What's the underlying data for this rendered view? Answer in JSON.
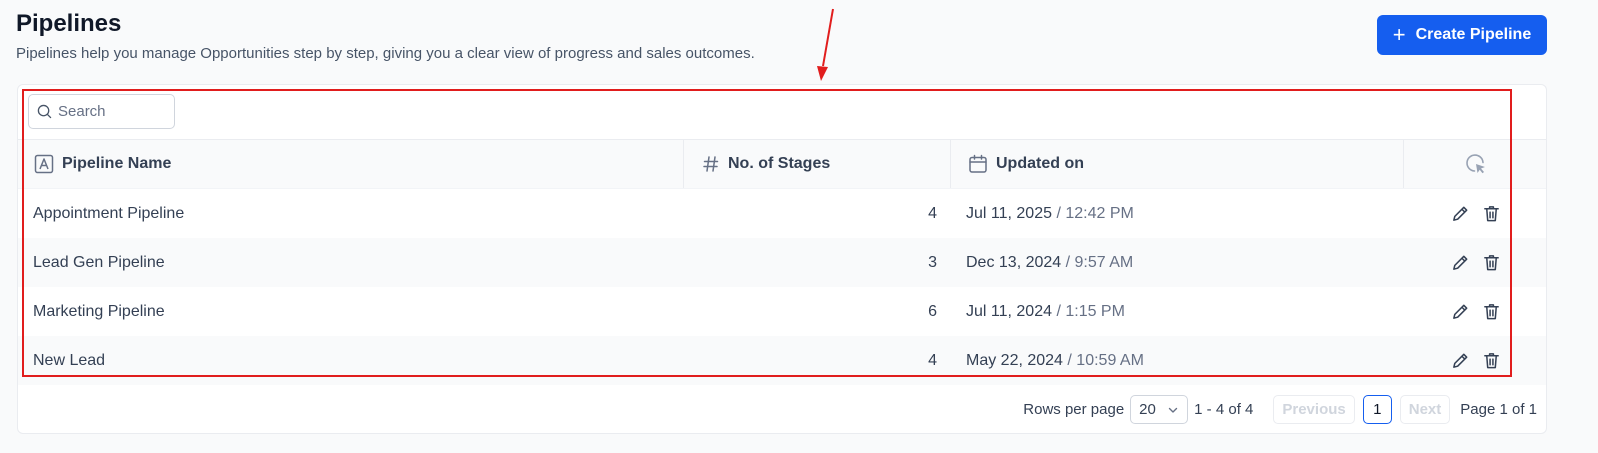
{
  "header": {
    "title": "Pipelines",
    "subtitle": "Pipelines help you manage Opportunities step by step, giving you a clear view of progress and sales outcomes.",
    "create_label": "Create Pipeline"
  },
  "search": {
    "placeholder": "Search"
  },
  "columns": {
    "name": "Pipeline Name",
    "stages": "No. of Stages",
    "updated": "Updated on"
  },
  "rows": [
    {
      "name": "Appointment Pipeline",
      "stages": "4",
      "date": "Jul 11, 2025",
      "sep": " / ",
      "time": "12:42 PM"
    },
    {
      "name": "Lead Gen Pipeline",
      "stages": "3",
      "date": "Dec 13, 2024",
      "sep": " / ",
      "time": "9:57 AM"
    },
    {
      "name": "Marketing Pipeline",
      "stages": "6",
      "date": "Jul 11, 2024",
      "sep": " / ",
      "time": "1:15 PM"
    },
    {
      "name": "New Lead",
      "stages": "4",
      "date": "May 22, 2024",
      "sep": " / ",
      "time": "10:59 AM"
    }
  ],
  "pagination": {
    "rows_per_page_label": "Rows per page",
    "rows_per_page_value": "20",
    "range": "1 - 4 of 4",
    "previous": "Previous",
    "current_page": "1",
    "next": "Next",
    "page_of": "Page 1 of 1"
  },
  "colors": {
    "accent": "#155eef",
    "highlight": "#e11d1d"
  }
}
